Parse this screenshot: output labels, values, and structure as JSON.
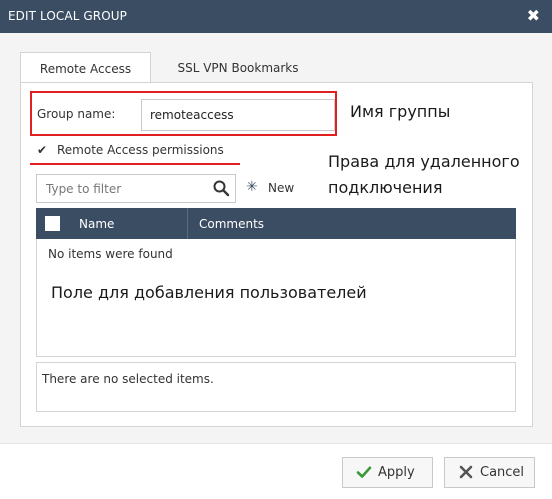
{
  "dialog": {
    "title": "EDIT LOCAL GROUP",
    "close_glyph": "✖"
  },
  "tabs": [
    {
      "label": "Remote Access",
      "active": true
    },
    {
      "label": "SSL VPN Bookmarks",
      "active": false
    }
  ],
  "form": {
    "group_name_label": "Group name:",
    "group_name_value": "remoteaccess",
    "permissions_label": "Remote Access permissions",
    "permissions_checked": true
  },
  "annotations": {
    "group_name": "Имя группы",
    "permissions_line1": "Права для удаленного",
    "permissions_line2": "подключения",
    "users_field": "Поле для добавления пользователей"
  },
  "filter": {
    "placeholder": "Type to filter",
    "new_label": "New"
  },
  "grid": {
    "columns": [
      "Name",
      "Comments"
    ],
    "empty_text": "No items were found"
  },
  "selected": {
    "empty_text": "There are no selected items."
  },
  "footer": {
    "apply_label": "Apply",
    "cancel_label": "Cancel"
  },
  "colors": {
    "header": "#3b4d63",
    "annotation_red": "#e02020",
    "apply_icon": "#3a9a3a",
    "cancel_icon": "#555555"
  }
}
